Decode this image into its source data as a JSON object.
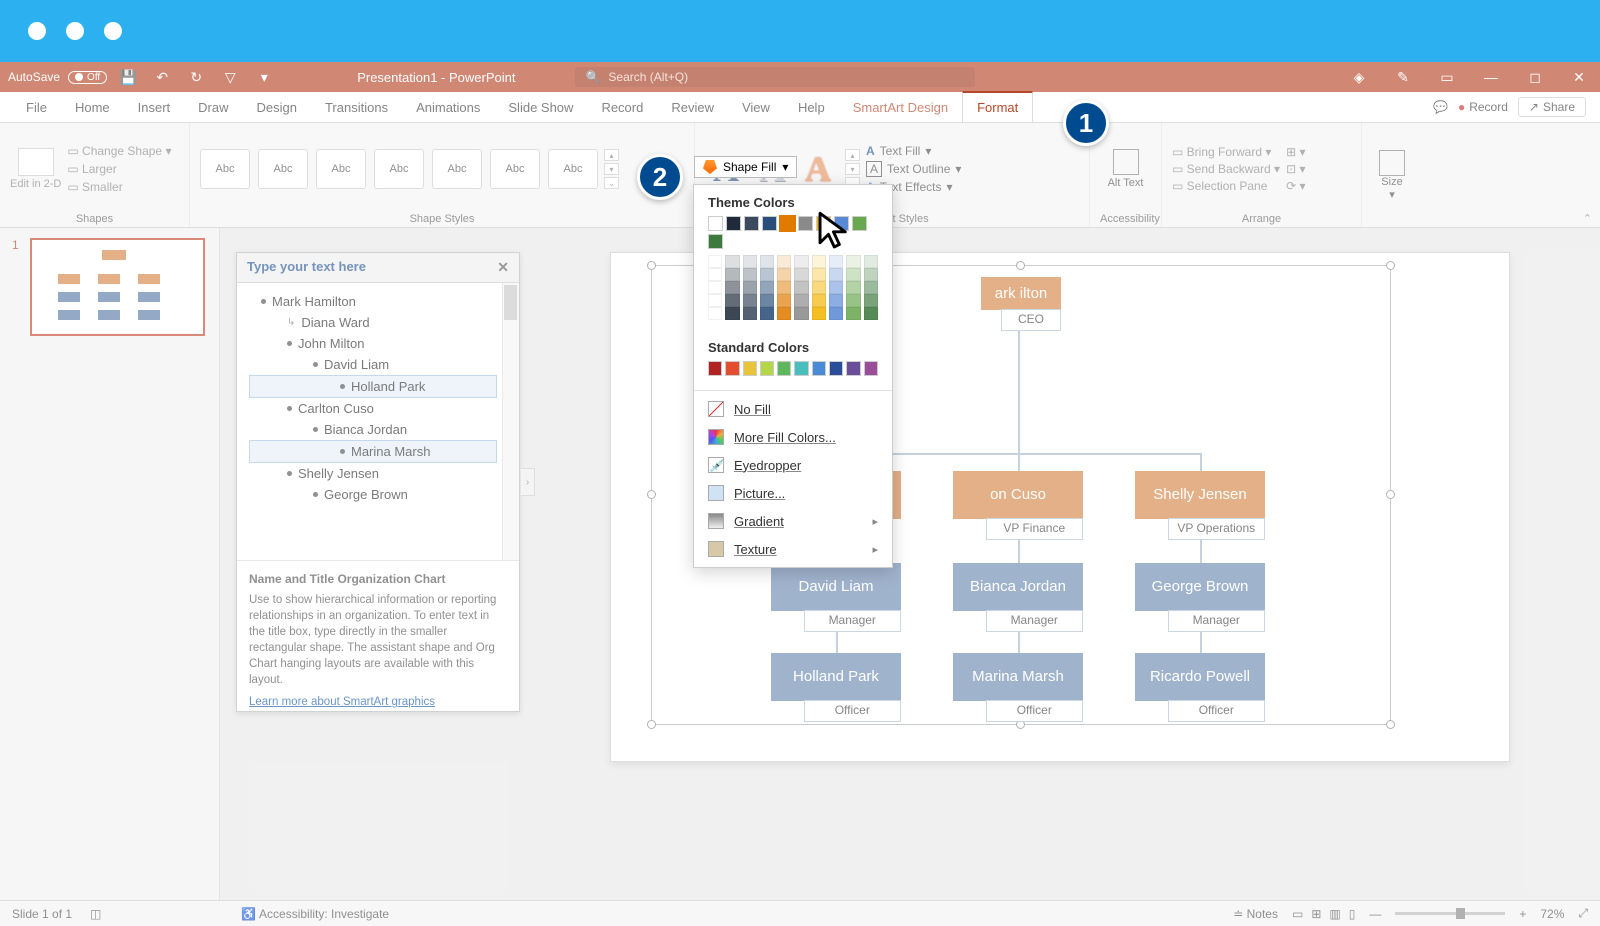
{
  "titlebar": {
    "autosave": "AutoSave",
    "autosave_state": "Off",
    "doc_title": "Presentation1 - PowerPoint",
    "search_placeholder": "Search (Alt+Q)"
  },
  "tabs": {
    "file": "File",
    "home": "Home",
    "insert": "Insert",
    "draw": "Draw",
    "design": "Design",
    "transitions": "Transitions",
    "animations": "Animations",
    "slideshow": "Slide Show",
    "record_tab": "Record",
    "review": "Review",
    "view": "View",
    "help": "Help",
    "smartart_design": "SmartArt Design",
    "format": "Format"
  },
  "tabs_right": {
    "record": "Record",
    "share": "Share"
  },
  "ribbon": {
    "shapes_group": "Shapes",
    "edit_in_2d": "Edit in 2-D",
    "change_shape": "Change Shape",
    "larger": "Larger",
    "smaller": "Smaller",
    "abc": "Abc",
    "shape_styles": "Shape Styles",
    "shape_fill": "Shape Fill",
    "wordart_styles": "WordArt Styles",
    "text_fill": "Text Fill",
    "text_outline": "Text Outline",
    "text_effects": "Text Effects",
    "alt_text": "Alt Text",
    "accessibility": "Accessibility",
    "bring_forward": "Bring Forward",
    "send_backward": "Send Backward",
    "selection_pane": "Selection Pane",
    "arrange": "Arrange",
    "size": "Size"
  },
  "thumb": {
    "num": "1"
  },
  "text_pane": {
    "header": "Type your text here",
    "items": [
      {
        "text": "Mark Hamilton",
        "indent": 0,
        "arrow": false,
        "sel": false
      },
      {
        "text": "Diana Ward",
        "indent": 1,
        "arrow": true,
        "sel": false
      },
      {
        "text": "John Milton",
        "indent": 1,
        "arrow": false,
        "sel": false
      },
      {
        "text": "David Liam",
        "indent": 2,
        "arrow": false,
        "sel": false
      },
      {
        "text": "Holland Park",
        "indent": 3,
        "arrow": false,
        "sel": true
      },
      {
        "text": "Carlton Cuso",
        "indent": 1,
        "arrow": false,
        "sel": false
      },
      {
        "text": "Bianca Jordan",
        "indent": 2,
        "arrow": false,
        "sel": false
      },
      {
        "text": "Marina Marsh",
        "indent": 3,
        "arrow": false,
        "sel": true
      },
      {
        "text": "Shelly Jensen",
        "indent": 1,
        "arrow": false,
        "sel": false
      },
      {
        "text": "George Brown",
        "indent": 2,
        "arrow": false,
        "sel": false
      }
    ],
    "footer_title": "Name and Title Organization Chart",
    "footer_body": "Use to show hierarchical information or reporting relationships in an organization. To enter text in the title box, type directly in the smaller rectangular shape. The assistant shape and Org Chart hanging layouts are available with this layout.",
    "footer_link": "Learn more about SmartArt graphics"
  },
  "org_chart": {
    "ceo": {
      "name": "Mark Hamilton",
      "name_short": "ark ilton",
      "title": "CEO"
    },
    "row2": [
      {
        "name": "John Milton",
        "name_short": "Jo",
        "title": "",
        "color": "orange"
      },
      {
        "name": "Carlton Cuso",
        "name_short": "on Cuso",
        "title": "VP Finance",
        "color": "orange"
      },
      {
        "name": "Shelly Jensen",
        "title": "VP Operations",
        "color": "orange"
      }
    ],
    "row3": [
      {
        "name": "David Liam",
        "title": "Manager"
      },
      {
        "name": "Bianca Jordan",
        "title": "Manager"
      },
      {
        "name": "George Brown",
        "title": "Manager"
      }
    ],
    "row4": [
      {
        "name": "Holland Park",
        "title": "Officer"
      },
      {
        "name": "Marina Marsh",
        "title": "Officer"
      },
      {
        "name": "Ricardo Powell",
        "title": "Officer"
      }
    ]
  },
  "fill_menu": {
    "theme_colors": "Theme Colors",
    "standard_colors": "Standard Colors",
    "no_fill": "No Fill",
    "more_fill": "More Fill Colors...",
    "eyedropper": "Eyedropper",
    "picture": "Picture...",
    "gradient": "Gradient",
    "texture": "Texture",
    "theme_row": [
      "#ffffff",
      "#1f2a3a",
      "#3b4a5e",
      "#2a4e7a",
      "#e07b00",
      "#8a8a8a",
      "#f4b400",
      "#5a8ad6",
      "#6aa84f",
      "#3d7a3d"
    ],
    "selected_idx": 4,
    "shade_rows": 5,
    "standard_row": [
      "#b22222",
      "#e34f2e",
      "#e8c43a",
      "#b6d64a",
      "#5db85d",
      "#4abdbd",
      "#4a8ad6",
      "#2a4e9a",
      "#6a4e9a",
      "#9a4e9a"
    ]
  },
  "statusbar": {
    "slide": "Slide 1 of 1",
    "accessibility": "Accessibility: Investigate",
    "notes": "Notes",
    "zoom": "72%"
  },
  "steps": {
    "s1": "1",
    "s2": "2"
  }
}
